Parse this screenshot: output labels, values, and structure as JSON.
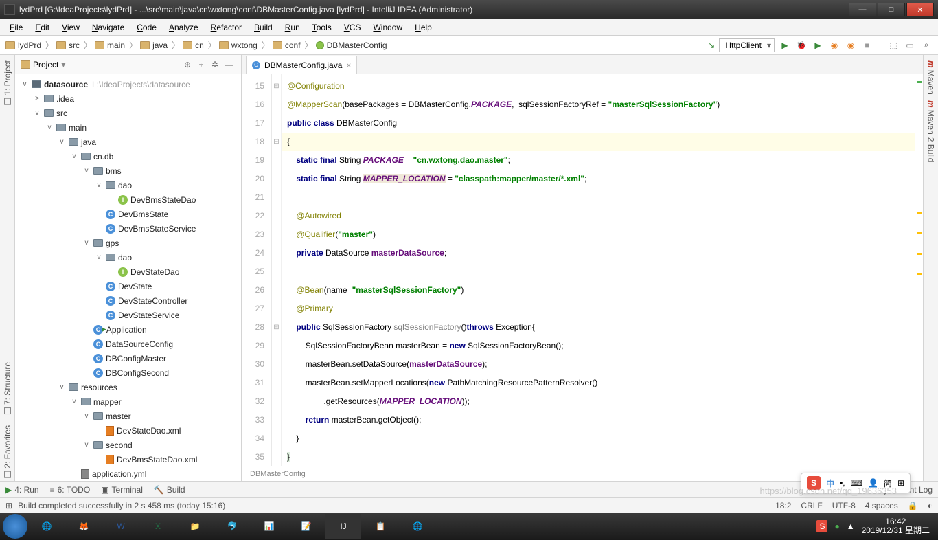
{
  "title": "lydPrd [G:\\IdeaProjects\\lydPrd] - ...\\src\\main\\java\\cn\\wxtong\\conf\\DBMasterConfig.java [lydPrd] - IntelliJ IDEA (Administrator)",
  "menu": [
    "File",
    "Edit",
    "View",
    "Navigate",
    "Code",
    "Analyze",
    "Refactor",
    "Build",
    "Run",
    "Tools",
    "VCS",
    "Window",
    "Help"
  ],
  "crumbs": [
    "lydPrd",
    "src",
    "main",
    "java",
    "cn",
    "wxtong",
    "conf",
    "DBMasterConfig"
  ],
  "run_config": "HttpClient",
  "proj_label": "Project",
  "tree": {
    "root": "datasource",
    "root_path": "L:\\IdeaProjects\\datasource",
    "items": [
      {
        "d": 1,
        "exp": ">",
        "ico": "folder",
        "lbl": ".idea"
      },
      {
        "d": 1,
        "exp": "v",
        "ico": "folder",
        "lbl": "src"
      },
      {
        "d": 2,
        "exp": "v",
        "ico": "folder",
        "lbl": "main"
      },
      {
        "d": 3,
        "exp": "v",
        "ico": "folder",
        "lbl": "java"
      },
      {
        "d": 4,
        "exp": "v",
        "ico": "folder",
        "lbl": "cn.db"
      },
      {
        "d": 5,
        "exp": "v",
        "ico": "folder",
        "lbl": "bms"
      },
      {
        "d": 6,
        "exp": "v",
        "ico": "folder",
        "lbl": "dao"
      },
      {
        "d": 7,
        "exp": "",
        "ico": "iface",
        "lbl": "DevBmsStateDao"
      },
      {
        "d": 6,
        "exp": "",
        "ico": "cls",
        "lbl": "DevBmsState"
      },
      {
        "d": 6,
        "exp": "",
        "ico": "cls",
        "lbl": "DevBmsStateService"
      },
      {
        "d": 5,
        "exp": "v",
        "ico": "folder",
        "lbl": "gps"
      },
      {
        "d": 6,
        "exp": "v",
        "ico": "folder",
        "lbl": "dao"
      },
      {
        "d": 7,
        "exp": "",
        "ico": "iface",
        "lbl": "DevStateDao"
      },
      {
        "d": 6,
        "exp": "",
        "ico": "cls",
        "lbl": "DevState"
      },
      {
        "d": 6,
        "exp": "",
        "ico": "cls",
        "lbl": "DevStateController"
      },
      {
        "d": 6,
        "exp": "",
        "ico": "cls",
        "lbl": "DevStateService"
      },
      {
        "d": 5,
        "exp": "",
        "ico": "cls",
        "lbl": "Application",
        "run": true
      },
      {
        "d": 5,
        "exp": "",
        "ico": "cls",
        "lbl": "DataSourceConfig"
      },
      {
        "d": 5,
        "exp": "",
        "ico": "cls",
        "lbl": "DBConfigMaster"
      },
      {
        "d": 5,
        "exp": "",
        "ico": "cls",
        "lbl": "DBConfigSecond"
      },
      {
        "d": 3,
        "exp": "v",
        "ico": "folder",
        "lbl": "resources"
      },
      {
        "d": 4,
        "exp": "v",
        "ico": "folder",
        "lbl": "mapper"
      },
      {
        "d": 5,
        "exp": "v",
        "ico": "folder",
        "lbl": "master"
      },
      {
        "d": 6,
        "exp": "",
        "ico": "xml",
        "lbl": "DevStateDao.xml"
      },
      {
        "d": 5,
        "exp": "v",
        "ico": "folder",
        "lbl": "second"
      },
      {
        "d": 6,
        "exp": "",
        "ico": "xml",
        "lbl": "DevBmsStateDao.xml"
      },
      {
        "d": 4,
        "exp": "",
        "ico": "yml",
        "lbl": "application.yml"
      }
    ]
  },
  "tab": "DBMasterConfig.java",
  "leftpanes": [
    "1: Project"
  ],
  "leftpanes2": [
    "7: Structure"
  ],
  "leftpanes3": [
    "2: Favorites"
  ],
  "rightpanes": [
    "Maven",
    "Maven-2 Build"
  ],
  "code": {
    "start": 15,
    "lines": [
      {
        "t": "<span class='ann'>@Configuration</span>"
      },
      {
        "t": "<span class='ann'>@MapperScan</span>(basePackages = DBMasterConfig.<span class='fld'>PACKAGE</span>,  sqlSessionFactoryRef = <span class='str'>\"masterSqlSessionFactory\"</span>)"
      },
      {
        "t": "<span class='kw'>public class</span> <span class='cls'>DBMasterConfig</span>"
      },
      {
        "t": "{",
        "hl": true
      },
      {
        "t": "    <span class='kw'>static final</span> String <span class='fld'>PACKAGE</span> = <span class='str'>\"cn.wxtong.dao.master\"</span>;"
      },
      {
        "t": "    <span class='kw'>static final</span> String <span class='fld' style='background:#f0e8d8'>MAPPER_LOCATION</span> = <span class='str'>\"classpath:mapper/master/*.xml\"</span>;"
      },
      {
        "t": ""
      },
      {
        "t": "    <span class='ann'>@Autowired</span>"
      },
      {
        "t": "    <span class='ann'>@Qualifier</span>(<span class='str'>\"master\"</span>)"
      },
      {
        "t": "    <span class='kw'>private</span> DataSource <span class='fld' style='font-style:normal;color:#660e7a'>masterDataSource</span>;"
      },
      {
        "t": ""
      },
      {
        "t": "    <span class='ann'>@Bean</span>(name=<span class='str'>\"masterSqlSessionFactory\"</span>)"
      },
      {
        "t": "    <span class='ann'>@Primary</span>"
      },
      {
        "t": "    <span class='kw'>public</span> SqlSessionFactory <span class='mthd'>sqlSessionFactory</span>()<span class='kw'>throws</span> Exception{"
      },
      {
        "t": "        SqlSessionFactoryBean masterBean = <span class='kw'>new</span> SqlSessionFactoryBean();"
      },
      {
        "t": "        masterBean.setDataSource(<span class='fld' style='font-style:normal'>masterDataSource</span>);"
      },
      {
        "t": "        masterBean.setMapperLocations(<span class='kw'>new</span> PathMatchingResourcePatternResolver()"
      },
      {
        "t": "                .getResources(<span class='fld'>MAPPER_LOCATION</span>));"
      },
      {
        "t": "        <span class='kw'>return</span> masterBean.getObject();"
      },
      {
        "t": "    }"
      },
      {
        "t": "<span style='background:#e0f0e0'>}</span>"
      }
    ]
  },
  "breadcrumb2": "DBMasterConfig",
  "bottom": {
    "run": "4: Run",
    "todo": "6: TODO",
    "term": "Terminal",
    "build": "Build",
    "evlog": "Event Log"
  },
  "status": {
    "msg": "Build completed successfully in 2 s 458 ms (today 15:16)",
    "pos": "18:2",
    "eol": "CRLF",
    "enc": "UTF-8",
    "indent": "4 spaces"
  },
  "tray": {
    "time": "16:42",
    "date": "2019/12/31 星期二"
  },
  "ime_label": "中",
  "watermark": "https://blog.csdn.net/qq_19636353"
}
